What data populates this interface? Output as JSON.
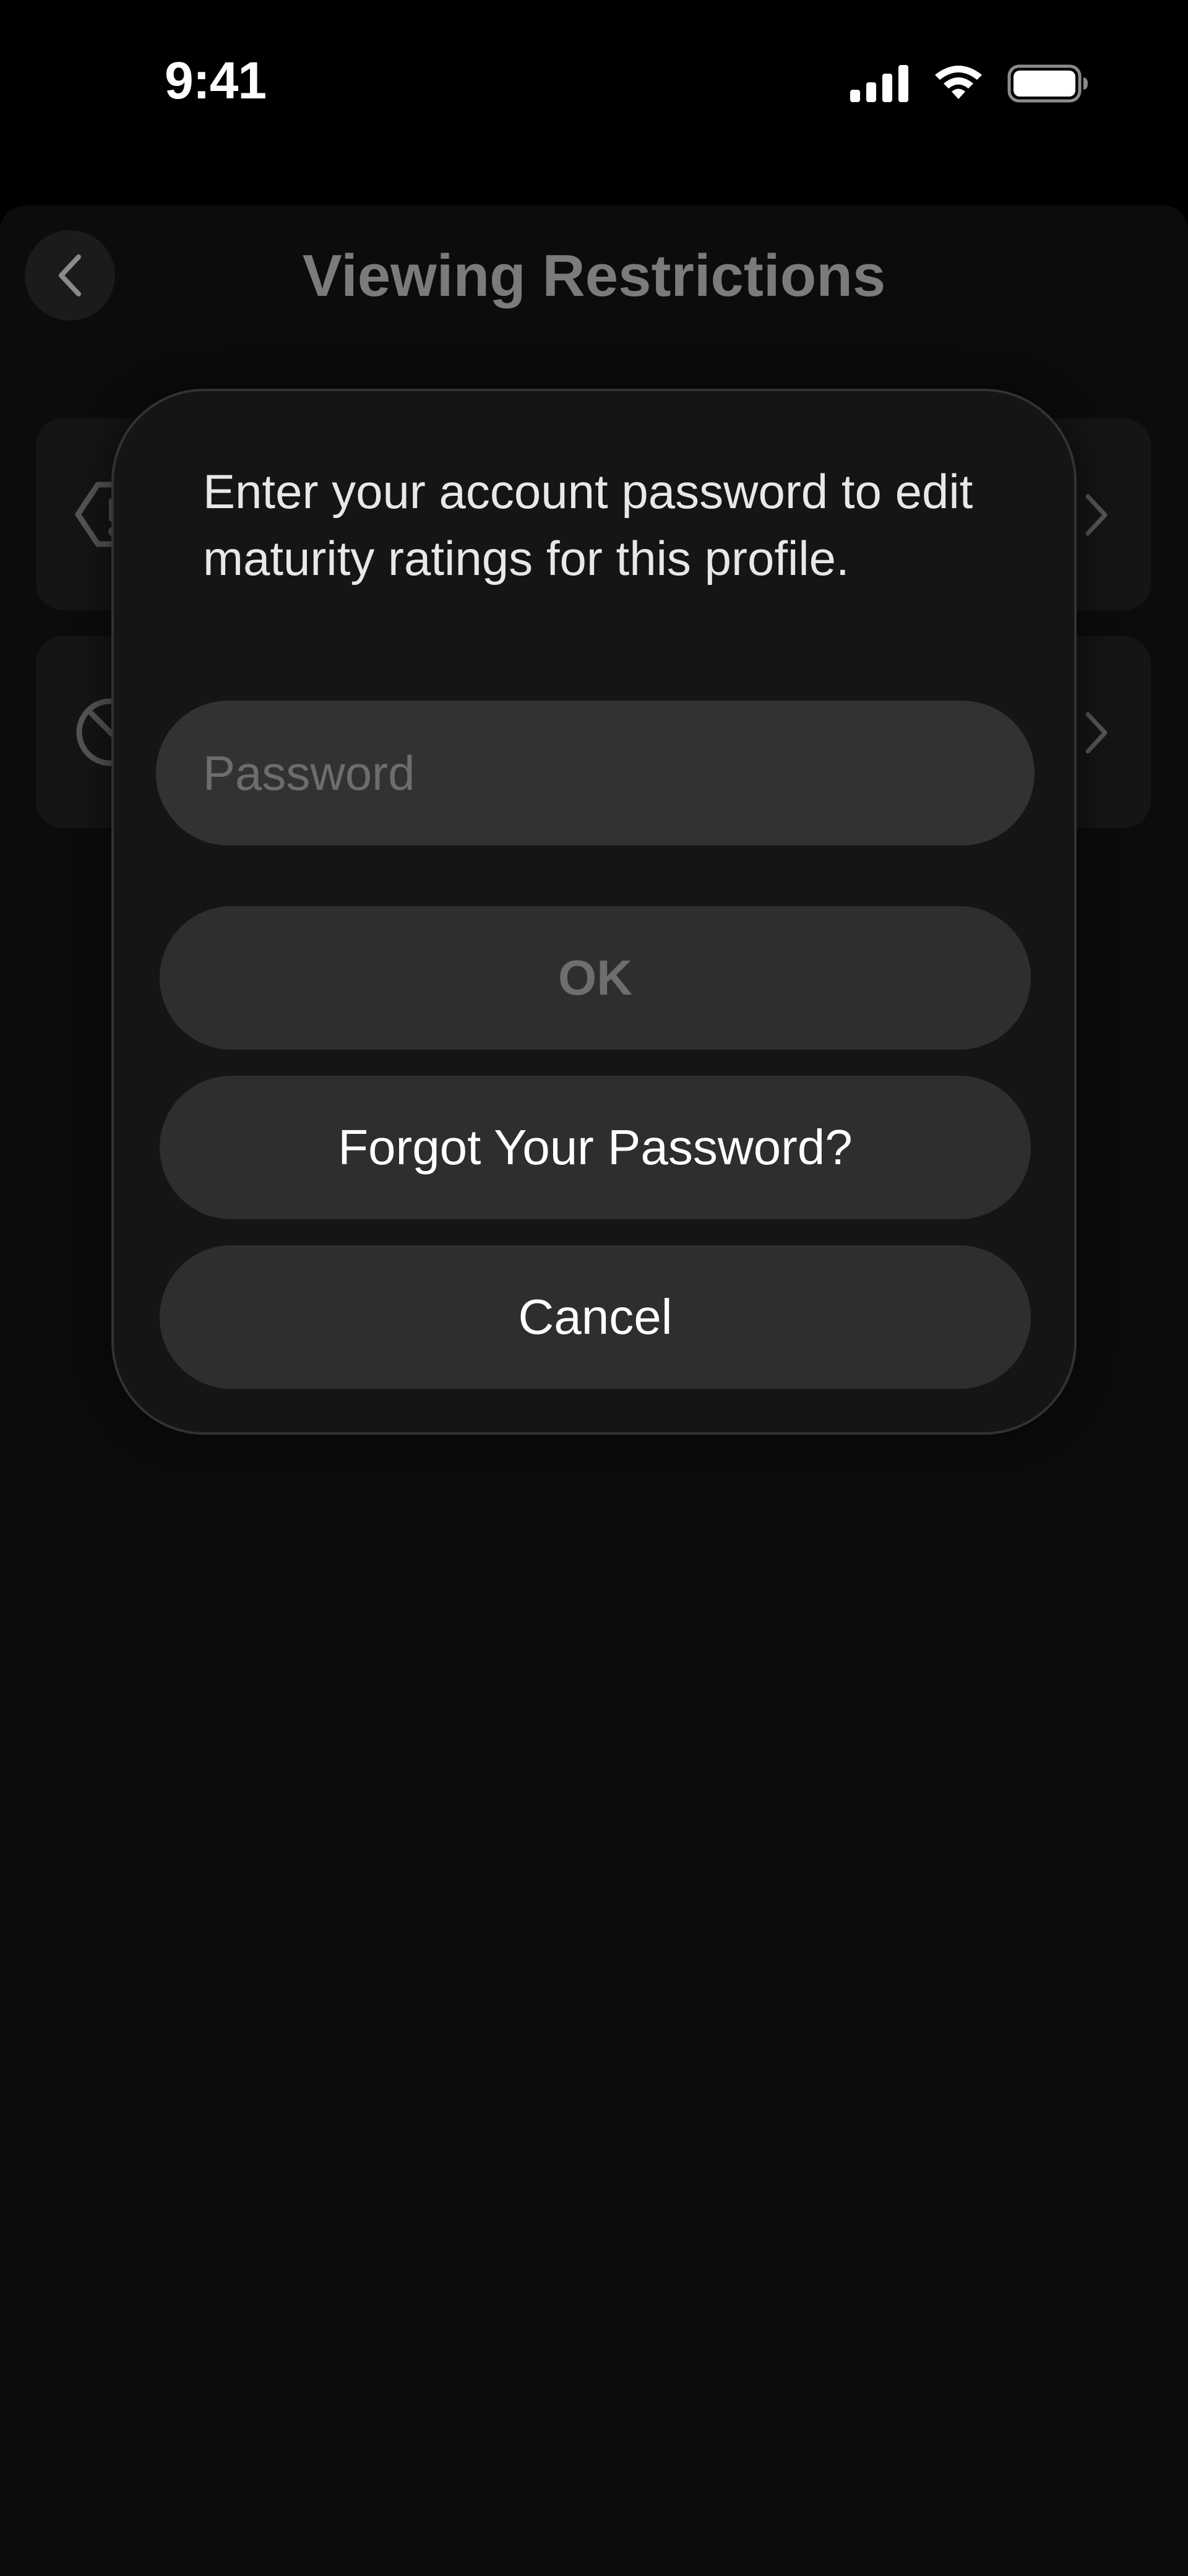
{
  "status_bar": {
    "time": "9:41",
    "icons": [
      "cellular-signal-icon",
      "wifi-icon",
      "battery-icon"
    ]
  },
  "header": {
    "title": "Viewing Restrictions",
    "back_icon": "chevron-left-icon"
  },
  "settings_rows": [
    {
      "icon": "maturity-warning-icon",
      "chevron": "chevron-right-icon"
    },
    {
      "icon": "block-circle-icon",
      "chevron": "chevron-right-icon"
    }
  ],
  "modal": {
    "message": "Enter your account password to edit maturity ratings for this profile.",
    "password": {
      "placeholder": "Password",
      "value": ""
    },
    "ok_label": "OK",
    "forgot_label": "Forgot Your Password?",
    "cancel_label": "Cancel"
  },
  "colors": {
    "background": "#000000",
    "sheet": "#0c0c0c",
    "modal": "#151515",
    "button": "#2e2e2e",
    "disabled_text": "#6e6e6e",
    "text": "#ffffff"
  }
}
